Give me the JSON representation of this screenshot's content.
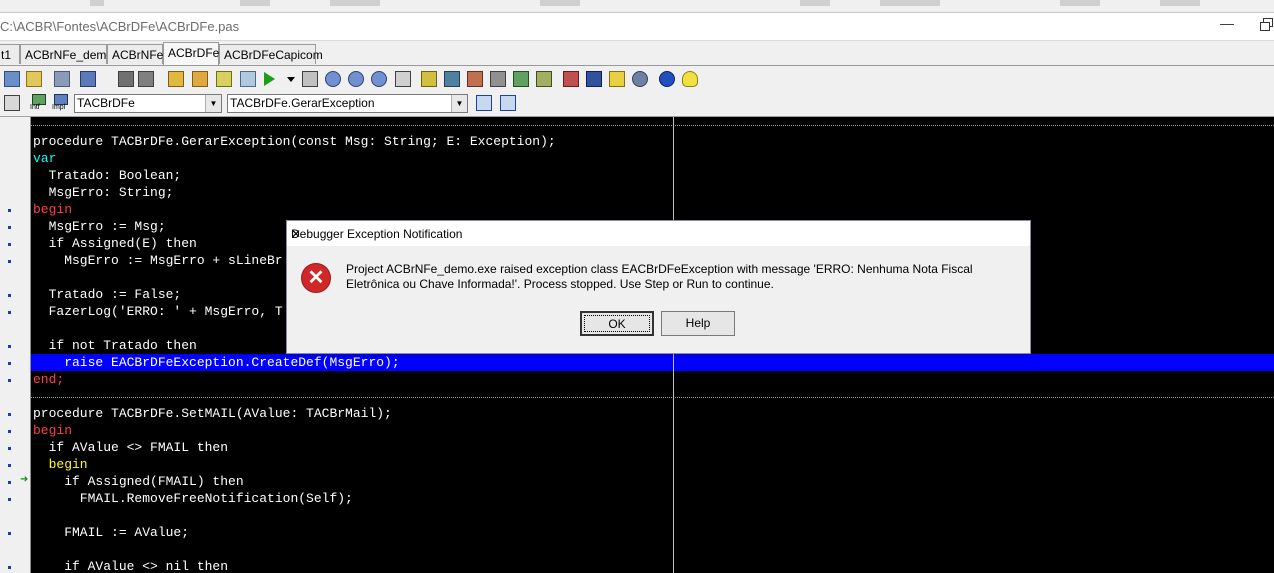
{
  "window": {
    "path": "C:\\ACBR\\Fontes\\ACBrDFe\\ACBrDFe.pas"
  },
  "tabs": [
    {
      "label": "t1"
    },
    {
      "label": "ACBrNFe_demo"
    },
    {
      "label": "ACBrNFe"
    },
    {
      "label": "ACBrDFe",
      "active": true
    },
    {
      "label": "ACBrDFeCapicom"
    }
  ],
  "toolbar2": {
    "intf_label": "Intf",
    "impl_label": "Impl",
    "class_combo": "TACBrDFe",
    "method_combo": "TACBrDFe.GerarException"
  },
  "code": {
    "lines": [
      "procedure TACBrDFe.GerarException(const Msg: String; E: Exception);",
      "var",
      "  Tratado: Boolean;",
      "  MsgErro: String;",
      "begin",
      "  MsgErro := Msg;",
      "  if Assigned(E) then",
      "    MsgErro := MsgErro + sLineBr",
      "",
      "  Tratado := False;",
      "  FazerLog('ERRO: ' + MsgErro, T",
      "",
      "  if not Tratado then",
      "    raise EACBrDFeException.CreateDef(MsgErro);",
      "end;",
      "",
      "procedure TACBrDFe.SetMAIL(AValue: TACBrMail);",
      "begin",
      "  if AValue <> FMAIL then",
      "  begin",
      "    if Assigned(FMAIL) then",
      "      FMAIL.RemoveFreeNotification(Self);",
      "",
      "    FMAIL := AValue;",
      "",
      "    if AValue <> nil then"
    ]
  },
  "dialog": {
    "title": "Debugger Exception Notification",
    "message": "Project ACBrNFe_demo.exe raised exception class EACBrDFeException with message 'ERRO: Nenhuma Nota Fiscal Eletrônica ou Chave Informada!'. Process stopped. Use Step or Run to continue.",
    "ok_label": "OK",
    "help_label": "Help"
  },
  "colors": {
    "editor_bg": "#000000",
    "exec_line": "#0000ff",
    "keyword": "#00ffff",
    "begin_end": "#ff4040",
    "then_kw": "#ffff00",
    "error_icon": "#d02828"
  }
}
